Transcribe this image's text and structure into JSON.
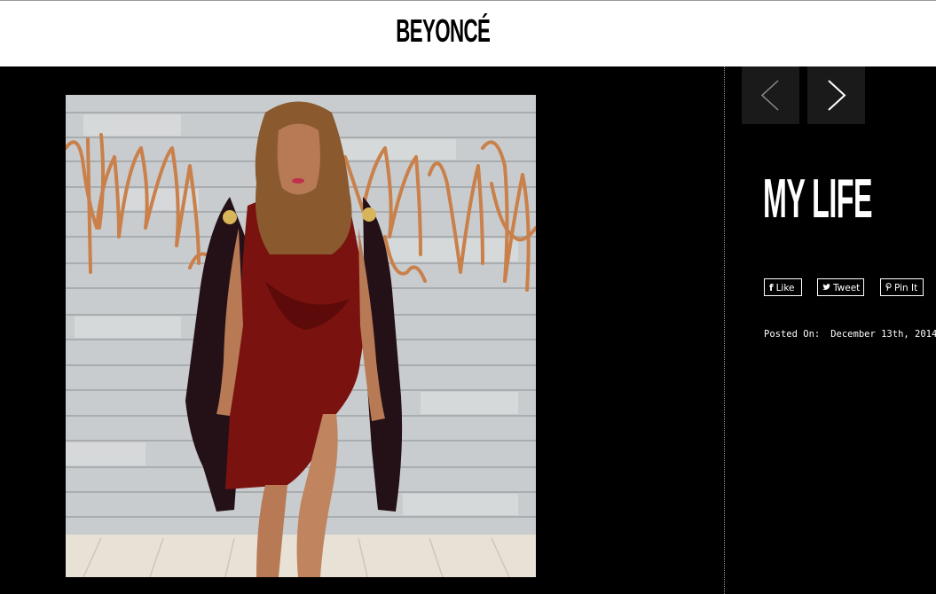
{
  "header": {
    "logo_text": "BEYONCÉ"
  },
  "nav": {
    "prev_icon": "chevron-left-icon",
    "next_icon": "chevron-right-icon"
  },
  "post": {
    "title": "MY LIFE",
    "posted_label": "Posted On:",
    "posted_date": "December 13th, 2014"
  },
  "share": {
    "like_label": "Like",
    "tweet_label": "Tweet",
    "pin_label": "Pin It"
  },
  "colors": {
    "background": "#000000",
    "header": "#ffffff",
    "nav_button": "#1a1a1a",
    "dress": "#7a1210",
    "copper": "#c9804a"
  }
}
